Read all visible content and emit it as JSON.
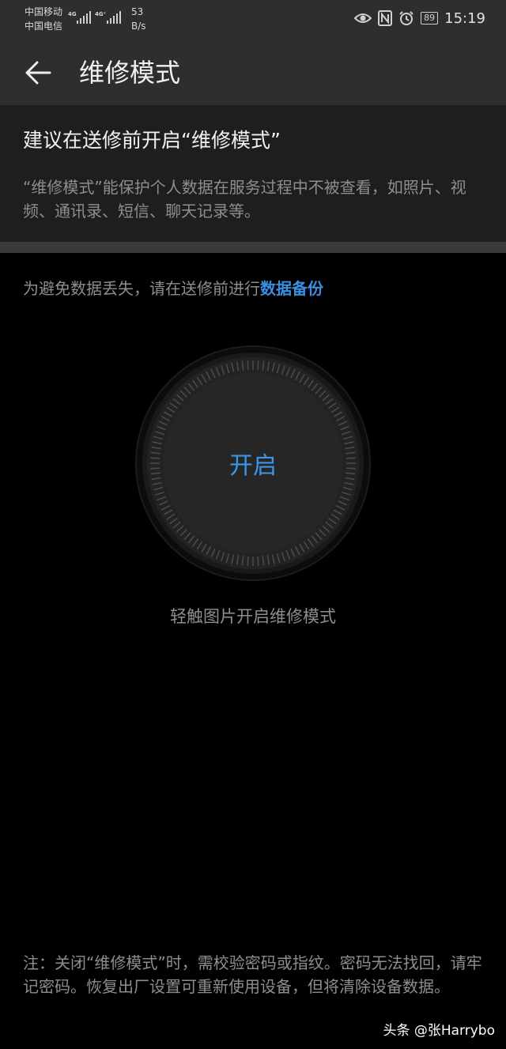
{
  "status_bar": {
    "carrier_1": "中国移动",
    "carrier_2": "中国电信",
    "network_1": "4G",
    "network_2": "4G⁺",
    "speed_value": "53",
    "speed_unit": "B/s",
    "battery": "89",
    "time": "15:19"
  },
  "header": {
    "title": "维修模式"
  },
  "info": {
    "heading": "建议在送修前开启“维修模式”",
    "description": "“维修模式”能保护个人数据在服务过程中不被查看，如照片、视频、通讯录、短信、聊天记录等。"
  },
  "backup": {
    "hint": "为避免数据丢失，请在送修前进行",
    "link": "数据备份"
  },
  "dial": {
    "label": "开启",
    "caption": "轻触图片开启维修模式"
  },
  "note": "注：关闭“维修模式”时，需校验密码或指纹。密码无法找回，请牢记密码。恢复出厂设置可重新使用设备，但将清除设备数据。",
  "watermark": "头条 @张Harrybo",
  "colors": {
    "accent": "#3a8fe0",
    "background": "#000000",
    "bar": "#2e2e2e"
  }
}
